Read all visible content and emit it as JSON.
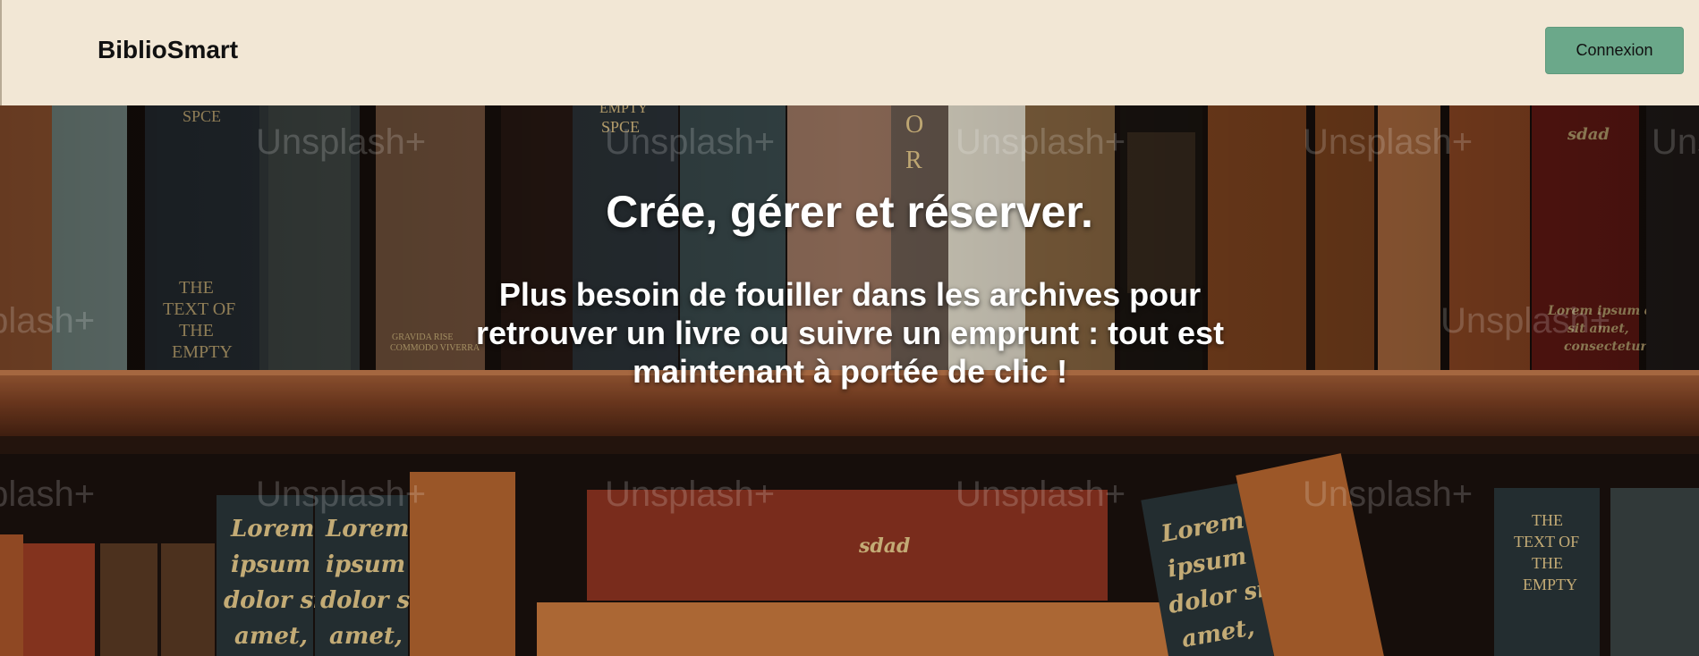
{
  "header": {
    "brand": "BiblioSmart",
    "login_label": "Connexion",
    "bg_color": "#f2e7d5",
    "button_color": "#6ba88a"
  },
  "hero": {
    "title": "Crée, gérer et réserver.",
    "subtitle": "Plus besoin de fouiller dans les archives pour retrouver un livre ou suivre un emprunt : tout est maintenant à portée de clic !",
    "image_watermark": "Unsplash+",
    "image_alt_icon": "bookshelf-image"
  }
}
